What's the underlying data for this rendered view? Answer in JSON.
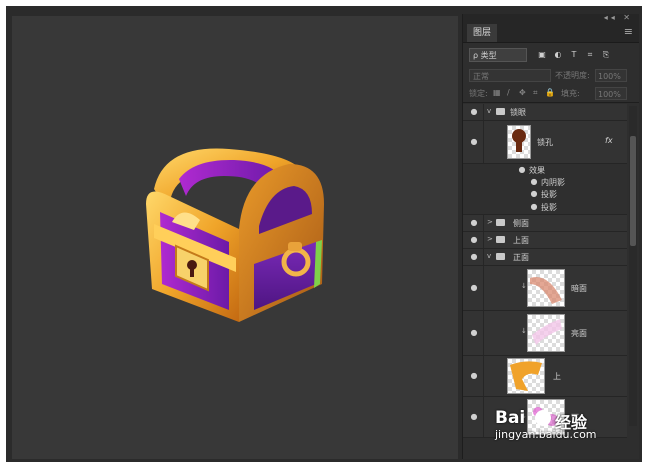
{
  "panel": {
    "tab_label": "图层",
    "top_icons": "◂◂ ✕",
    "menu_icon": "≡",
    "filter": {
      "kind_label": "ρ 类型",
      "icons": [
        "▣",
        "◐",
        "T",
        "⌗",
        "⎘"
      ]
    },
    "blend": {
      "mode": "正常",
      "opacity_label": "不透明度:",
      "opacity_value": "100%"
    },
    "lock": {
      "label": "锁定:",
      "icons": [
        "▦",
        "/",
        "✥",
        "⌗",
        "🔒"
      ],
      "fill_label": "填充:",
      "fill_value": "100%"
    }
  },
  "layers": [
    {
      "name": "锁眼",
      "type": "group"
    },
    {
      "name": "锁孔",
      "type": "layer",
      "fx": "fx"
    },
    {
      "name": "效果",
      "type": "effects"
    },
    {
      "name": "内阴影",
      "type": "effect"
    },
    {
      "name": "投影",
      "type": "effect"
    },
    {
      "name": "投影",
      "type": "effect"
    },
    {
      "name": "侧面",
      "type": "group"
    },
    {
      "name": "上面",
      "type": "group"
    },
    {
      "name": "正面",
      "type": "group"
    },
    {
      "name": "暗面",
      "type": "layer"
    },
    {
      "name": "亮面",
      "type": "layer"
    },
    {
      "name": "上",
      "type": "layer"
    },
    {
      "name": "下",
      "type": "layer"
    }
  ],
  "watermark": {
    "logo": "Bai",
    "logo_suffix": "经验",
    "url": "jingyan.baidu.com"
  },
  "colors": {
    "canvas": "#383838",
    "panel": "#2e2e2e",
    "gold": "#e8a52a",
    "purple": "#7a1fb0",
    "magenta": "#c93fd0"
  }
}
